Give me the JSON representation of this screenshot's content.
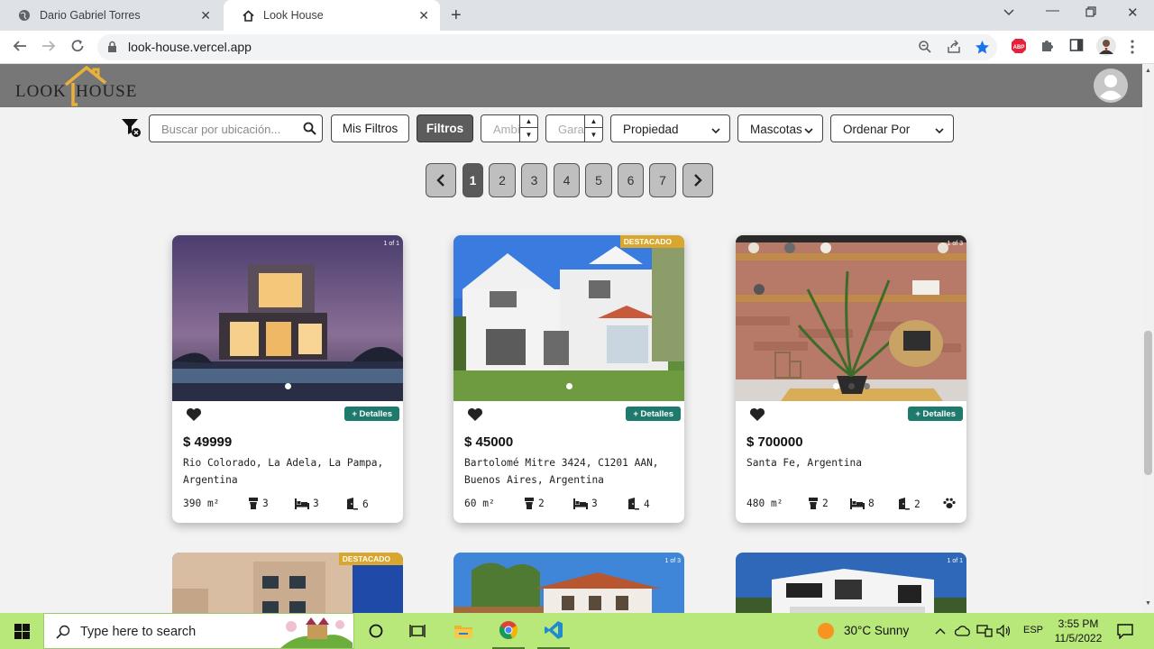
{
  "browser": {
    "tabs": [
      {
        "title": "Dario Gabriel Torres",
        "active": false
      },
      {
        "title": "Look House",
        "active": true
      }
    ],
    "url": "look-house.vercel.app"
  },
  "site": {
    "logo_left": "LOOK",
    "logo_right": "HOUSE"
  },
  "filters": {
    "search_placeholder": "Buscar por ubicación...",
    "my_filters_label": "Mis Filtros",
    "filters_label": "Filtros",
    "rooms_placeholder": "Ambientes",
    "garages_placeholder": "Garage",
    "property_label": "Propiedad",
    "pets_label": "Mascotas",
    "sort_label": "Ordenar Por"
  },
  "pagination": {
    "pages": [
      "1",
      "2",
      "3",
      "4",
      "5",
      "6",
      "7"
    ],
    "current": "1"
  },
  "listings": [
    {
      "price": "$ 49999",
      "address": "Rio Colorado, La Adela, La Pampa, Argentina",
      "area": "390 m²",
      "baths": "3",
      "beds": "3",
      "garages": "6",
      "pets": false,
      "photo_counter": "1 of 1",
      "badge": "",
      "details_label": "+ Detalles"
    },
    {
      "price": "$ 45000",
      "address": "Bartolomé Mitre 3424, C1201 AAN, Buenos Aires, Argentina",
      "area": "60 m²",
      "baths": "2",
      "beds": "3",
      "garages": "4",
      "pets": false,
      "photo_counter": "",
      "badge": "DESTACADO",
      "details_label": "+ Detalles"
    },
    {
      "price": "$ 700000",
      "address": "Santa Fe, Argentina",
      "area": "480 m²",
      "baths": "2",
      "beds": "8",
      "garages": "2",
      "pets": true,
      "photo_counter": "1 of 3",
      "badge": "",
      "details_label": "+ Detalles"
    }
  ],
  "listings_row2": [
    {
      "badge": "DESTACADO",
      "photo_counter": ""
    },
    {
      "badge": "",
      "photo_counter": "1 of 3"
    },
    {
      "badge": "",
      "photo_counter": "1 of 1"
    }
  ],
  "taskbar": {
    "search_text": "Type here to search",
    "weather": "30°C  Sunny",
    "language": "ESP",
    "time": "3:55 PM",
    "date": "11/5/2022"
  },
  "colors": {
    "header_bg": "#777777",
    "details_button": "#1f7a6e",
    "badge": "#d9a62e",
    "taskbar": "#b8e87a"
  }
}
